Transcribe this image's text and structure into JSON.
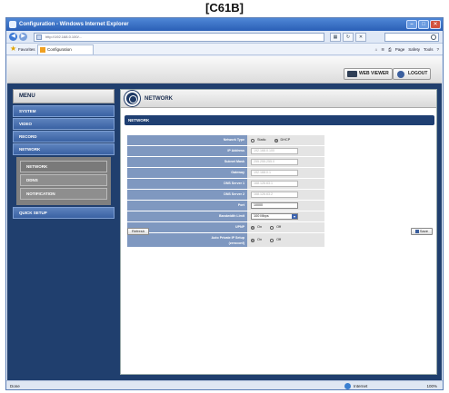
{
  "caption": "[C61B]",
  "browser": {
    "title": "Configuration - Windows Internet Explorer",
    "address": "http://192.168.0.100/...",
    "favorites_label": "Favorites",
    "tab_label": "Configuration",
    "cmd": [
      "Page",
      "Safety",
      "Tools"
    ],
    "status_text": "Done",
    "zone_text": "Internet",
    "zoom_text": "100%"
  },
  "topbar": {
    "web_viewer_label": "WEB VIEWER",
    "logout_label": "LOGOUT"
  },
  "menu": {
    "header": "MENU",
    "items": [
      "SYSTEM",
      "VIDEO",
      "RECORD",
      "NETWORK"
    ],
    "submenu": [
      "NETWORK",
      "DDNS",
      "NOTIFICATION"
    ],
    "after": [
      "QUICK SETUP"
    ]
  },
  "panel": {
    "title": "NETWORK",
    "section": "NETWORK",
    "fields": {
      "network_type": {
        "label": "Network Type",
        "options": [
          "Static",
          "DHCP"
        ],
        "selected": "DHCP"
      },
      "ip_address": {
        "label": "IP Address",
        "value": "192.168.0.100"
      },
      "subnet_mask": {
        "label": "Subnet Mask",
        "value": "255.255.255.0"
      },
      "gateway": {
        "label": "Gateway",
        "value": "192.168.0.1"
      },
      "dns1": {
        "label": "DNS Server 1",
        "value": "168.126.63.1"
      },
      "dns2": {
        "label": "DNS Server 2",
        "value": "168.126.63.2"
      },
      "port": {
        "label": "Port",
        "value": "10000"
      },
      "bandwidth": {
        "label": "Bandwidth Limit",
        "value": "100 Mbps"
      },
      "upnp": {
        "label": "UPNP",
        "options": [
          "On",
          "Off"
        ],
        "selected": "On"
      },
      "auto_private": {
        "label": "Auto Private IP Setup",
        "label_2": "(zeroconf)",
        "options": [
          "On",
          "Off"
        ],
        "selected": "On"
      }
    },
    "refresh_label": "Refresh",
    "save_label": "Save"
  }
}
